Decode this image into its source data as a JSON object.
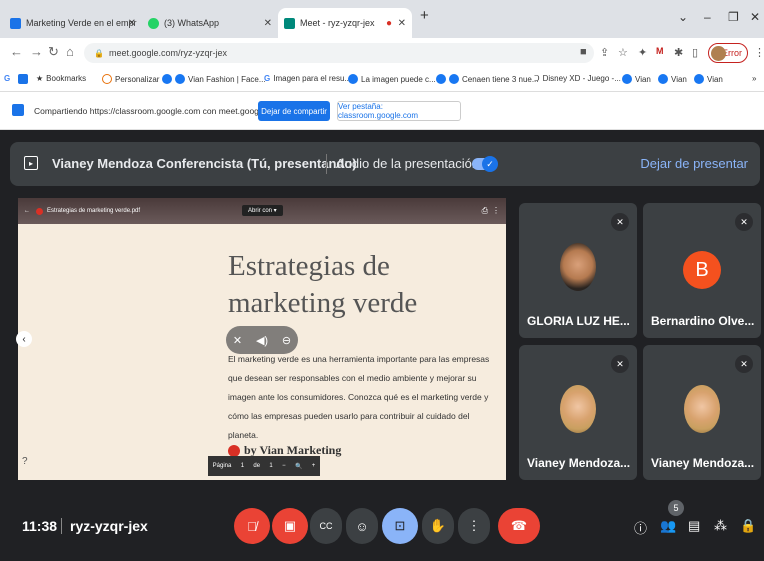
{
  "browser": {
    "tabs": [
      {
        "label": "Marketing Verde en el empr",
        "favicon_color": "#1a73e8"
      },
      {
        "label": "(3) WhatsApp",
        "favicon_color": "#25d366"
      },
      {
        "label": "Meet - ryz-yzqr-jex",
        "favicon_color": "#00897b"
      }
    ],
    "url": "meet.google.com/ryz-yzqr-jex",
    "error_label": "Error",
    "bookmarks": [
      {
        "label": "Bookmarks",
        "color": "#555"
      },
      {
        "label": "Personalizar",
        "color": "#e8710a"
      },
      {
        "label": "Vian Fashion | Face...",
        "color": "#1877f2"
      },
      {
        "label": "Imagen para el resu...",
        "color": "#4285f4"
      },
      {
        "label": "La imagen puede c...",
        "color": "#1877f2"
      },
      {
        "label": "Cenaen tiene 3 nue...",
        "color": "#1877f2"
      },
      {
        "label": "Disney XD - Juego -...",
        "color": "#333"
      },
      {
        "label": "Vian",
        "color": "#1877f2"
      },
      {
        "label": "Vian",
        "color": "#1877f2"
      },
      {
        "label": "Vian",
        "color": "#1877f2"
      }
    ]
  },
  "sharebar": {
    "text": "Compartiendo https://classroom.google.com con meet.google.com",
    "stop_label": "Dejar de compartir",
    "newtab_label": "Ver pestaña: classroom.google.com"
  },
  "presenting": {
    "name": "Vianey Mendoza Conferencista (Tú, presentando)",
    "audio_label": "Audio de la presentación",
    "stop_label": "Dejar de presentar"
  },
  "slide": {
    "file_name": "Estrategias de marketing verde.pdf",
    "open_with": "Abrir con",
    "title": "Estrategias de marketing verde",
    "body": "El marketing verde es una herramienta importante para las empresas que desean ser responsables con el medio ambiente y mejorar su imagen ante los consumidores. Conozca qué es el marketing verde y cómo las empresas pueden usarlo para contribuir al cuidado del planeta.",
    "byline": "by Vian Marketing",
    "page_label": "Página",
    "page_current": "1",
    "page_of": "de",
    "page_total": "1"
  },
  "participants": [
    {
      "name": "GLORIA LUZ HE..."
    },
    {
      "name": "Bernardino Olve...",
      "initial": "B"
    },
    {
      "name": "Vianey Mendoza..."
    },
    {
      "name": "Vianey Mendoza..."
    }
  ],
  "bottom": {
    "time": "11:38",
    "meeting_code": "ryz-yzqr-jex",
    "participant_count": "5"
  },
  "colors": {
    "meet_bg": "#202124",
    "accent_blue": "#8ab4f8",
    "danger_red": "#ea4335"
  }
}
